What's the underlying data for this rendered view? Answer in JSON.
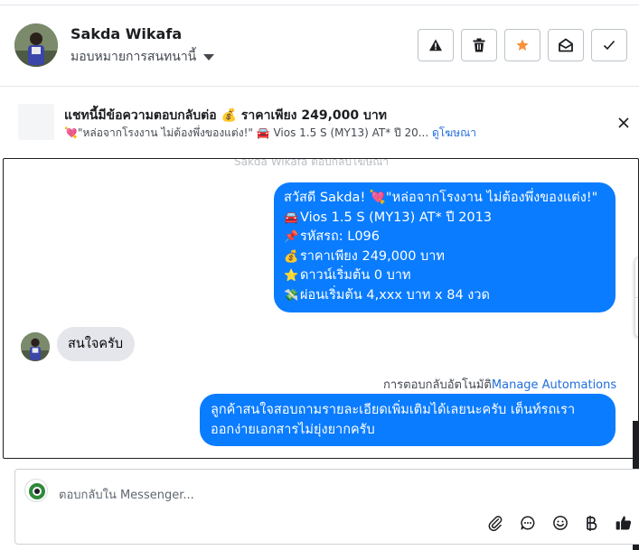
{
  "header": {
    "contact_name": "Sakda Wikafa",
    "assign_label": "มอบหมายการสนทนานี้",
    "actions": [
      {
        "name": "spam-button",
        "icon": "warning-icon"
      },
      {
        "name": "delete-button",
        "icon": "trash-icon"
      },
      {
        "name": "star-button",
        "icon": "star-icon",
        "color": "#f7923b"
      },
      {
        "name": "mark-unread-button",
        "icon": "envelope-open-icon"
      },
      {
        "name": "mark-done-button",
        "icon": "checkmark-icon"
      }
    ]
  },
  "ad_banner": {
    "title": "แชทนี้มีข้อความตอบกลับต่อ 💰 ราคาเพียง 249,000 บาท",
    "subtitle": "💘\"หล่อจากโรงงาน ไม่ต้องพึ่งของแต่ง!\" 🚘 Vios 1.5 S (MY13) AT* ปี 20...",
    "link_label": "ดูโฆษณา"
  },
  "chat": {
    "faded_notice": "Sakda Wikafa ตอบกลับโฆษณา",
    "ad_message_lines": [
      {
        "emoji": "",
        "text": "สวัสดี Sakda! 💘\"หล่อจากโรงงาน ไม่ต้องพึ่งของแต่ง!\""
      },
      {
        "emoji": "🚘",
        "text": "Vios 1.5 S (MY13) AT* ปี 2013"
      },
      {
        "emoji": "📌",
        "text": "รหัสรถ: L096"
      },
      {
        "emoji": "💰",
        "text": "ราคาเพียง 249,000 บาท"
      },
      {
        "emoji": "⭐",
        "text": "ดาวน์เริ่มต้น 0 บาท"
      },
      {
        "emoji": "💸",
        "text": "ผ่อนเริ่มต้น 4,xxx บาท x 84 งวด"
      }
    ],
    "customer_reply": "สนใจครับ",
    "auto_reply_label": "การตอบกลับอัตโนมัติ",
    "auto_reply_link": "Manage Automations",
    "auto_reply_lines": [
      "ลูกค้าสนใจสอบถามรายละเอียดเพิ่มเติมได้เลยนะครับ เต็นท์รถเรา",
      "ออกง่ายเอกสารไม่ยุ่งยากครับ"
    ]
  },
  "composer": {
    "placeholder": "ตอบกลับใน Messenger...",
    "tools": [
      "paperclip-icon",
      "saved-reply-icon",
      "emoji-icon",
      "baht-icon",
      "thumbs-up-icon"
    ]
  },
  "colors": {
    "outgoing_bubble": "#0a7cff",
    "incoming_bubble": "#e4e6eb",
    "link": "#216fdb",
    "star": "#f7923b"
  }
}
